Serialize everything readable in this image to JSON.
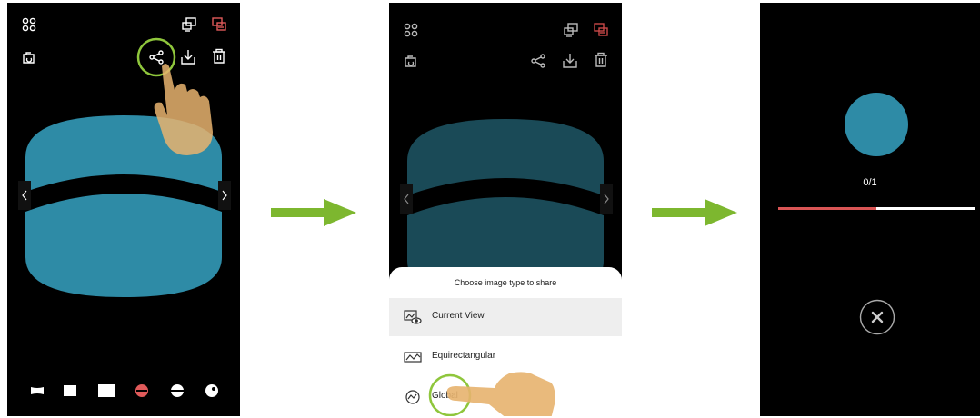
{
  "screen1": {
    "top_icons": [
      "grid-icon",
      "display-icon",
      "display-active-icon"
    ],
    "second_icons": [
      "rotate-icon",
      "share-icon",
      "download-icon",
      "trash-icon"
    ],
    "bottom_modes": [
      "flat-mode-icon",
      "square-mode-icon",
      "wide-mode-icon",
      "little-planet-mode-icon",
      "dome-mode-icon",
      "sphere-mode-icon"
    ],
    "nav": [
      "chevron-left-icon",
      "chevron-right-icon"
    ]
  },
  "screen2": {
    "sheet_title": "Choose image type to share",
    "options": [
      {
        "label": "Current View",
        "icon": "current-view-icon",
        "selected": true
      },
      {
        "label": "Equirectangular",
        "icon": "equirectangular-icon",
        "selected": false
      },
      {
        "label": "Global",
        "icon": "global-icon",
        "selected": false
      }
    ]
  },
  "screen3": {
    "counter": "0/1",
    "progress": 0.5,
    "close_icon": "close-icon"
  },
  "colors": {
    "accent": "#2e8ba6",
    "accent_dim": "#1a4a57",
    "active_red": "#e05a5a",
    "highlight_green": "#8fc63c",
    "arrow_green": "#7db72f",
    "hand": "#e7b36e"
  }
}
